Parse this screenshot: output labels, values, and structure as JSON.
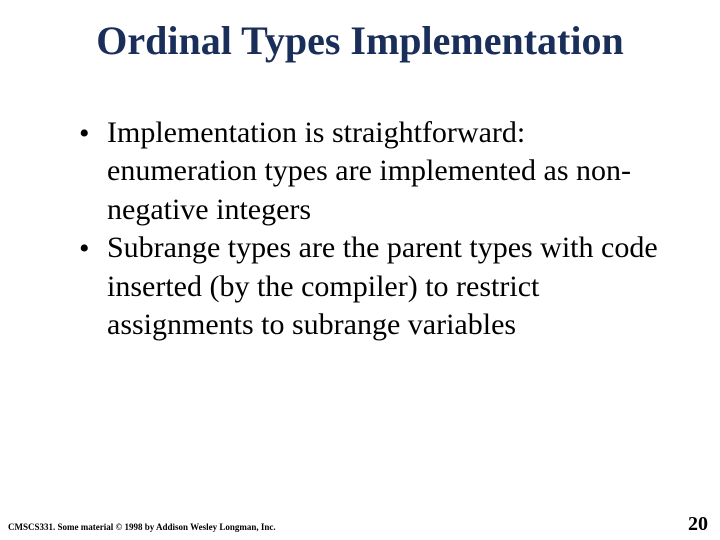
{
  "slide": {
    "title": "Ordinal Types Implementation",
    "bullets": [
      "Implementation is straightforward: enumeration types are implemented as non-negative integers",
      "Subrange types are the parent types with code inserted (by the compiler) to restrict assignments to subrange variables"
    ],
    "footer_left": "CMSCS331. Some material © 1998 by Addison Wesley Longman, Inc.",
    "page_number": "20"
  }
}
